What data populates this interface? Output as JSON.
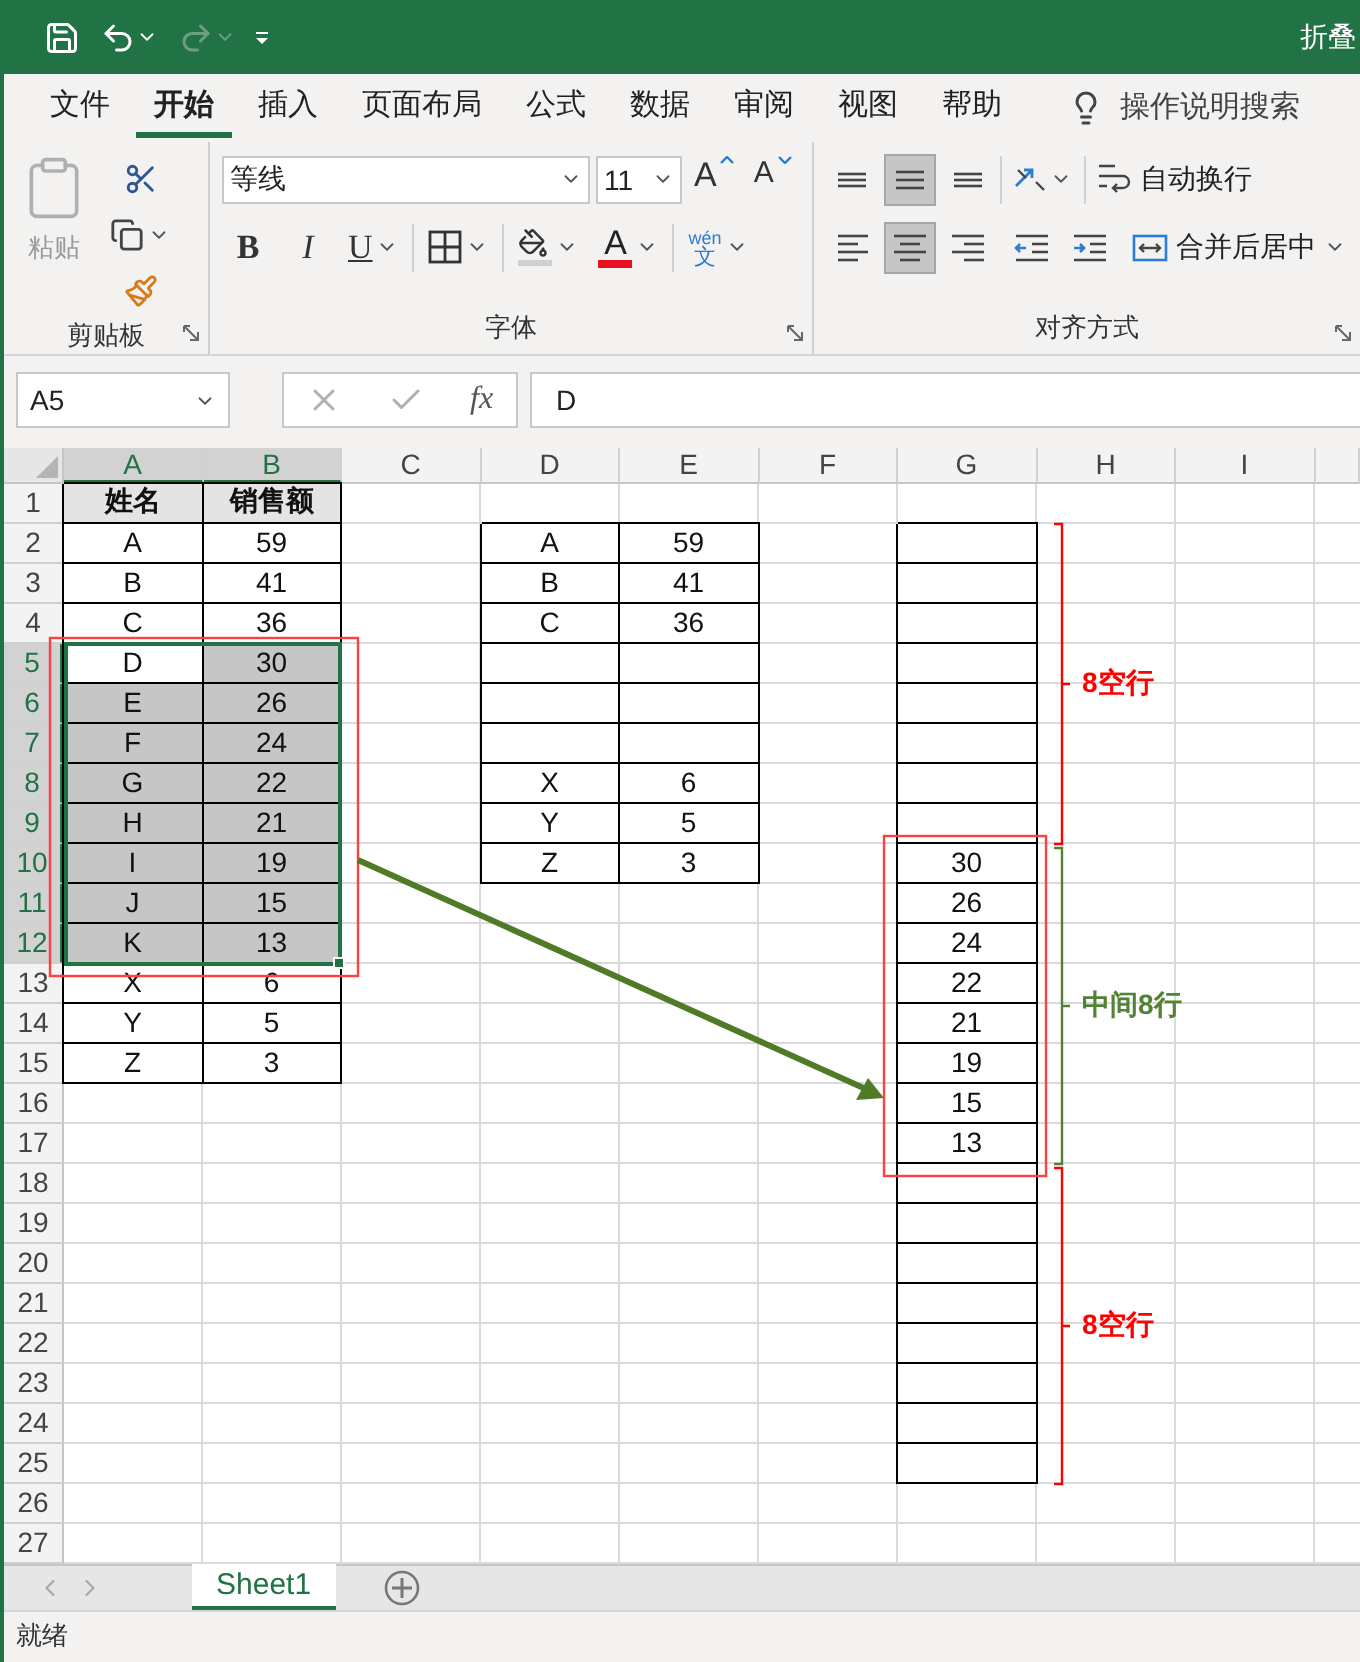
{
  "window": {
    "title": "折叠"
  },
  "menu_tabs": [
    {
      "label": "文件",
      "selected": false
    },
    {
      "label": "开始",
      "selected": true
    },
    {
      "label": "插入",
      "selected": false
    },
    {
      "label": "页面布局",
      "selected": false
    },
    {
      "label": "公式",
      "selected": false
    },
    {
      "label": "数据",
      "selected": false
    },
    {
      "label": "审阅",
      "selected": false
    },
    {
      "label": "视图",
      "selected": false
    },
    {
      "label": "帮助",
      "selected": false
    }
  ],
  "tell_me": {
    "placeholder": "操作说明搜索"
  },
  "ribbon": {
    "clipboard": {
      "paste_label": "粘贴",
      "group_label": "剪贴板"
    },
    "font": {
      "font_name": "等线",
      "font_size": "11",
      "grow_label": "A",
      "shrink_label": "A",
      "bold_label": "B",
      "italic_label": "I",
      "underline_label": "U",
      "font_color_label": "A",
      "phonetic_top": "wén",
      "phonetic_bottom": "文",
      "group_label": "字体"
    },
    "alignment": {
      "vertical": [
        {
          "kind": "top",
          "selected": false
        },
        {
          "kind": "middle",
          "selected": true
        },
        {
          "kind": "bottom",
          "selected": false
        }
      ],
      "horizontal": [
        {
          "kind": "left",
          "selected": false
        },
        {
          "kind": "center",
          "selected": true
        },
        {
          "kind": "right",
          "selected": false
        }
      ],
      "wrap_label": "自动换行",
      "merge_label": "合并后居中",
      "group_label": "对齐方式"
    }
  },
  "formula_bar": {
    "name_box": "A5",
    "function_label": "fx",
    "formula": "D"
  },
  "sheet": {
    "column_headers": [
      {
        "label": "A",
        "selected": true
      },
      {
        "label": "B",
        "selected": true
      },
      {
        "label": "C",
        "selected": false
      },
      {
        "label": "D",
        "selected": false
      },
      {
        "label": "E",
        "selected": false
      },
      {
        "label": "F",
        "selected": false
      },
      {
        "label": "G",
        "selected": false
      },
      {
        "label": "H",
        "selected": false
      },
      {
        "label": "I",
        "selected": false
      }
    ],
    "row_headers": [
      {
        "label": "1",
        "selected": false
      },
      {
        "label": "2",
        "selected": false
      },
      {
        "label": "3",
        "selected": false
      },
      {
        "label": "4",
        "selected": false
      },
      {
        "label": "5",
        "selected": true
      },
      {
        "label": "6",
        "selected": true
      },
      {
        "label": "7",
        "selected": true
      },
      {
        "label": "8",
        "selected": true
      },
      {
        "label": "9",
        "selected": true
      },
      {
        "label": "10",
        "selected": true
      },
      {
        "label": "11",
        "selected": true
      },
      {
        "label": "12",
        "selected": true
      },
      {
        "label": "13",
        "selected": false
      },
      {
        "label": "14",
        "selected": false
      },
      {
        "label": "15",
        "selected": false
      },
      {
        "label": "16",
        "selected": false
      },
      {
        "label": "17",
        "selected": false
      },
      {
        "label": "18",
        "selected": false
      },
      {
        "label": "19",
        "selected": false
      },
      {
        "label": "20",
        "selected": false
      },
      {
        "label": "21",
        "selected": false
      },
      {
        "label": "22",
        "selected": false
      },
      {
        "label": "23",
        "selected": false
      },
      {
        "label": "24",
        "selected": false
      },
      {
        "label": "25",
        "selected": false
      },
      {
        "label": "26",
        "selected": false
      },
      {
        "label": "27",
        "selected": false
      }
    ]
  },
  "source_table": {
    "columns": [
      "姓名",
      "销售额"
    ],
    "rows": [
      {
        "name": "A",
        "sales": "59",
        "selected": false
      },
      {
        "name": "B",
        "sales": "41",
        "selected": false
      },
      {
        "name": "C",
        "sales": "36",
        "selected": false
      },
      {
        "name": "D",
        "sales": "30",
        "selected": true
      },
      {
        "name": "E",
        "sales": "26",
        "selected": true
      },
      {
        "name": "F",
        "sales": "24",
        "selected": true
      },
      {
        "name": "G",
        "sales": "22",
        "selected": true
      },
      {
        "name": "H",
        "sales": "21",
        "selected": true
      },
      {
        "name": "I",
        "sales": "19",
        "selected": true
      },
      {
        "name": "J",
        "sales": "15",
        "selected": true
      },
      {
        "name": "K",
        "sales": "13",
        "selected": true
      },
      {
        "name": "X",
        "sales": "6",
        "selected": false
      },
      {
        "name": "Y",
        "sales": "5",
        "selected": false
      },
      {
        "name": "Z",
        "sales": "3",
        "selected": false
      }
    ]
  },
  "middle_table": {
    "rows": [
      {
        "kind": "data",
        "name": "A",
        "sales": "59"
      },
      {
        "kind": "data",
        "name": "B",
        "sales": "41"
      },
      {
        "kind": "data",
        "name": "C",
        "sales": "36"
      },
      {
        "kind": "blank"
      },
      {
        "kind": "blank"
      },
      {
        "kind": "blank"
      },
      {
        "kind": "data",
        "name": "X",
        "sales": "6"
      },
      {
        "kind": "data",
        "name": "Y",
        "sales": "5"
      },
      {
        "kind": "data",
        "name": "Z",
        "sales": "3"
      }
    ]
  },
  "result_column": {
    "rows": [
      {
        "kind": "blank"
      },
      {
        "kind": "blank"
      },
      {
        "kind": "blank"
      },
      {
        "kind": "blank"
      },
      {
        "kind": "blank"
      },
      {
        "kind": "blank"
      },
      {
        "kind": "blank"
      },
      {
        "kind": "blank"
      },
      {
        "kind": "value",
        "value": "30"
      },
      {
        "kind": "value",
        "value": "26"
      },
      {
        "kind": "value",
        "value": "24"
      },
      {
        "kind": "value",
        "value": "22"
      },
      {
        "kind": "value",
        "value": "21"
      },
      {
        "kind": "value",
        "value": "19"
      },
      {
        "kind": "value",
        "value": "15"
      },
      {
        "kind": "value",
        "value": "13"
      },
      {
        "kind": "blank"
      },
      {
        "kind": "blank"
      },
      {
        "kind": "blank"
      },
      {
        "kind": "blank"
      },
      {
        "kind": "blank"
      },
      {
        "kind": "blank"
      },
      {
        "kind": "blank"
      },
      {
        "kind": "blank"
      }
    ]
  },
  "annotations": [
    {
      "label": "8空行",
      "color": "#ff0000"
    },
    {
      "label": "中间8行",
      "color": "#548235"
    },
    {
      "label": "8空行",
      "color": "#ff0000"
    }
  ],
  "sheet_tabs": [
    {
      "label": "Sheet1",
      "selected": true
    }
  ],
  "status_bar": {
    "text": "就绪"
  }
}
